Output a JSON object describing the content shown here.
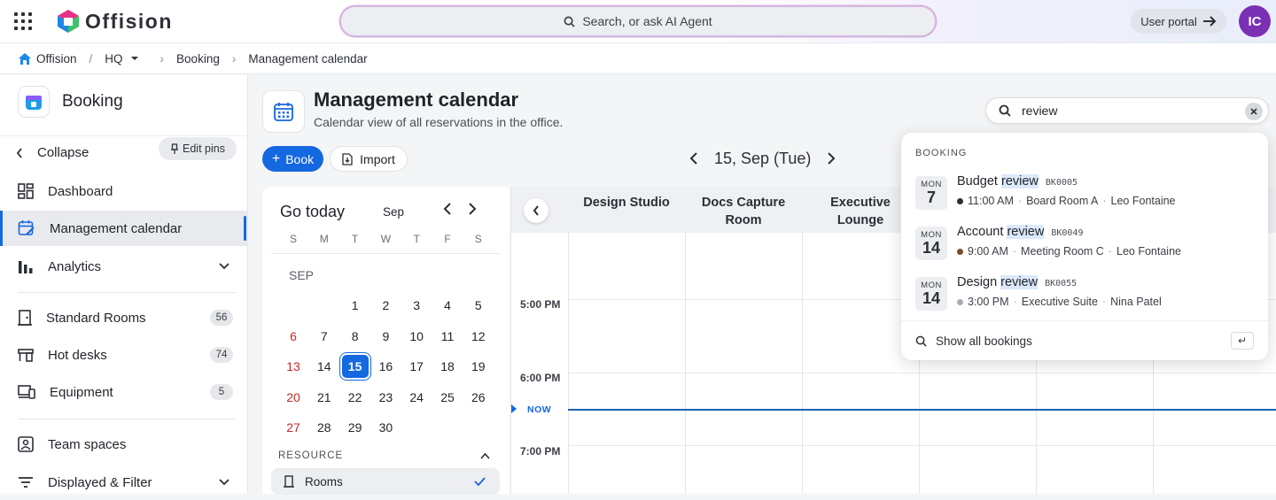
{
  "app": {
    "name": "Offision",
    "user_initials": "IC",
    "search_placeholder": "Search, or ask AI Agent",
    "portal_label": "User portal"
  },
  "breadcrumb": {
    "home": "Offision",
    "location": "HQ",
    "module": "Booking",
    "page": "Management calendar"
  },
  "sidebar": {
    "title": "Booking",
    "collapse_label": "Collapse",
    "edit_pins_label": "Edit pins",
    "items": [
      {
        "label": "Dashboard"
      },
      {
        "label": "Management calendar"
      },
      {
        "label": "Analytics"
      },
      {
        "label": "Standard Rooms",
        "count": "56"
      },
      {
        "label": "Hot desks",
        "count": "74"
      },
      {
        "label": "Equipment",
        "count": "5"
      },
      {
        "label": "Team spaces"
      },
      {
        "label": "Displayed & Filter"
      }
    ]
  },
  "header": {
    "title": "Management calendar",
    "subtitle": "Calendar view of all reservations in the office.",
    "book_label": "Book",
    "import_label": "Import",
    "current_date": "15, Sep (Tue)"
  },
  "mini_calendar": {
    "go_today": "Go today",
    "month_short": "Sep",
    "month_label": "SEP",
    "weekdays": [
      "S",
      "M",
      "T",
      "W",
      "T",
      "F",
      "S"
    ],
    "weeks": [
      [
        "",
        "",
        "1",
        "2",
        "3",
        "4",
        "5"
      ],
      [
        "6",
        "7",
        "8",
        "9",
        "10",
        "11",
        "12"
      ],
      [
        "13",
        "14",
        "15",
        "16",
        "17",
        "18",
        "19"
      ],
      [
        "20",
        "21",
        "22",
        "23",
        "24",
        "25",
        "26"
      ],
      [
        "27",
        "28",
        "29",
        "30",
        "",
        "",
        ""
      ]
    ],
    "today": "15",
    "resource_label": "RESOURCE",
    "resource_item": "Rooms"
  },
  "calendar": {
    "columns": [
      "Design Studio",
      "Docs Capture Room",
      "Executive Lounge"
    ],
    "times": [
      "5:00 PM",
      "6:00 PM",
      "7:00 PM"
    ],
    "now_label": "NOW"
  },
  "search": {
    "query": "review"
  },
  "results": {
    "section": "BOOKING",
    "items": [
      {
        "month": "MON",
        "day": "7",
        "title_pre": "Budget",
        "title_hl": "review",
        "code": "BK0005",
        "time": "11:00 AM",
        "room": "Board Room A",
        "person": "Leo Fontaine",
        "dot": "#2b2f36"
      },
      {
        "month": "MON",
        "day": "14",
        "title_pre": "Account",
        "title_hl": "review",
        "code": "BK0049",
        "time": "9:00 AM",
        "room": "Meeting Room C",
        "person": "Leo Fontaine",
        "dot": "#7a4a2a"
      },
      {
        "month": "MON",
        "day": "14",
        "title_pre": "Design",
        "title_hl": "review",
        "code": "BK0055",
        "time": "3:00 PM",
        "room": "Executive Suite",
        "person": "Nina Patel",
        "dot": "#a9adb3"
      }
    ],
    "footer": "Show all bookings"
  }
}
